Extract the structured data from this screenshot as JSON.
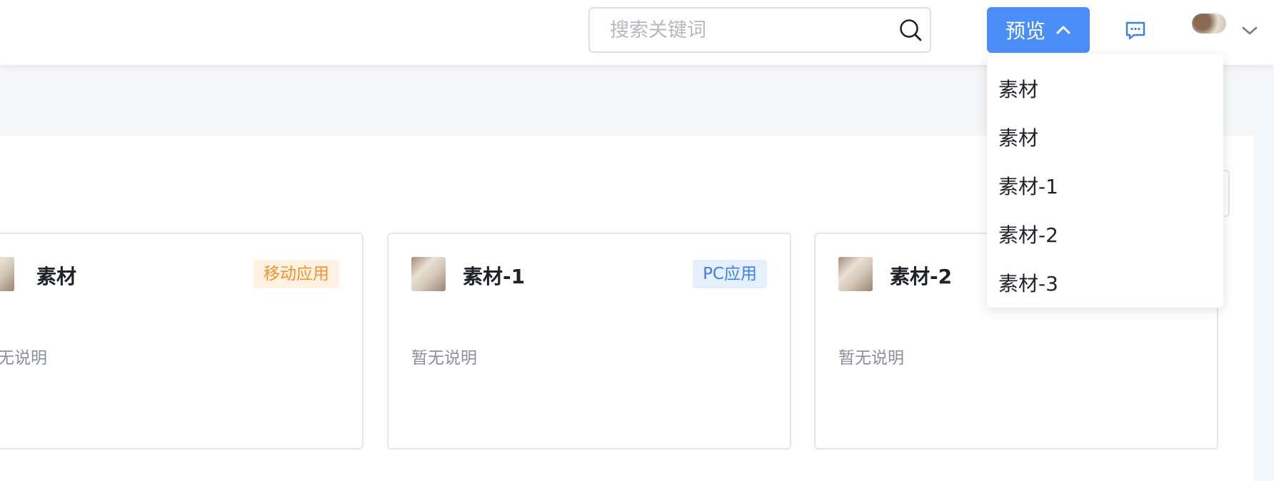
{
  "header": {
    "search": {
      "placeholder": "搜索关键词",
      "value": ""
    },
    "preview_button_label": "预览",
    "icons": {
      "search": "search-icon",
      "preview_toggle": "chevron-up-icon",
      "messages": "message-icon",
      "user_menu": "chevron-down-icon"
    }
  },
  "dropdown": {
    "items": [
      {
        "label": "素材"
      },
      {
        "label": "素材"
      },
      {
        "label": "素材-1"
      },
      {
        "label": "素材-2"
      },
      {
        "label": "素材-3"
      }
    ]
  },
  "cards": [
    {
      "title": "素材",
      "tag": "移动应用",
      "description": "暂无说明"
    },
    {
      "title": "素材-1",
      "tag": "PC应用",
      "description": "暂无说明"
    },
    {
      "title": "素材-2",
      "tag": "",
      "description": "暂无说明"
    }
  ],
  "colors": {
    "accent": "#4c8ef7",
    "tag_mobile_bg": "#fff2e3",
    "tag_mobile_text": "#f2922d",
    "tag_pc_bg": "#e6f0fd",
    "tag_pc_text": "#3d7fe8"
  }
}
